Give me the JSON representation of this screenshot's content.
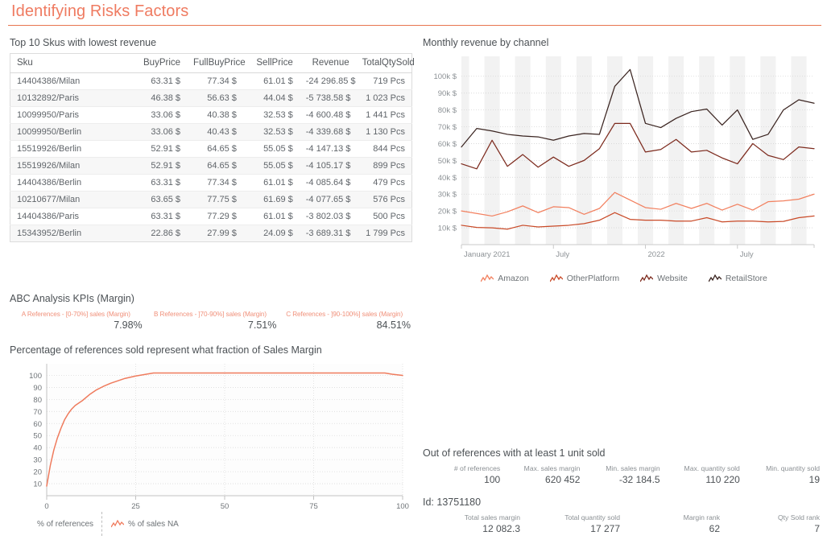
{
  "header": {
    "title": "Identifying Risks Factors",
    "accent": "#e8754f",
    "title_color": "#ef7b61"
  },
  "sku_table": {
    "title": "Top 10 Skus with lowest revenue",
    "columns": [
      "Sku",
      "BuyPrice",
      "FullBuyPrice",
      "SellPrice",
      "Revenue",
      "TotalQtySold"
    ],
    "rows": [
      [
        "14404386/Milan",
        "63.31 $",
        "77.34 $",
        "61.01 $",
        "-24 296.85 $",
        "719 Pcs"
      ],
      [
        "10132892/Paris",
        "46.38 $",
        "56.63 $",
        "44.04 $",
        "-5 738.58 $",
        "1 023 Pcs"
      ],
      [
        "10099950/Paris",
        "33.06 $",
        "40.38 $",
        "32.53 $",
        "-4 600.48 $",
        "1 441 Pcs"
      ],
      [
        "10099950/Berlin",
        "33.06 $",
        "40.43 $",
        "32.53 $",
        "-4 339.68 $",
        "1 130 Pcs"
      ],
      [
        "15519926/Berlin",
        "52.91 $",
        "64.65 $",
        "55.05 $",
        "-4 147.13 $",
        "844 Pcs"
      ],
      [
        "15519926/Milan",
        "52.91 $",
        "64.65 $",
        "55.05 $",
        "-4 105.17 $",
        "899 Pcs"
      ],
      [
        "14404386/Berlin",
        "63.31 $",
        "77.34 $",
        "61.01 $",
        "-4 085.64 $",
        "479 Pcs"
      ],
      [
        "10210677/Milan",
        "63.65 $",
        "77.75 $",
        "61.69 $",
        "-4 077.65 $",
        "576 Pcs"
      ],
      [
        "14404386/Paris",
        "63.31 $",
        "77.29 $",
        "61.01 $",
        "-3 802.03 $",
        "500 Pcs"
      ],
      [
        "15343952/Berlin",
        "22.86 $",
        "27.99 $",
        "24.09 $",
        "-3 689.31 $",
        "1 799 Pcs"
      ]
    ]
  },
  "revenue_chart": {
    "title": "Monthly revenue by channel"
  },
  "abc": {
    "title": "ABC Analysis KPIs (Margin)",
    "items": [
      {
        "label": "A References - [0-70%] sales (Margin)",
        "value": "7.98%"
      },
      {
        "label": "B References - ]70-90%] sales (Margin)",
        "value": "7.51%"
      },
      {
        "label": "C References - ]90-100%] sales (Margin)",
        "value": "84.51%"
      }
    ]
  },
  "pareto_chart": {
    "title": "Percentage of references sold represent what fraction of Sales Margin",
    "legend_axis_label": "% of references",
    "legend_series_label": "% of sales NA"
  },
  "references": {
    "title": "Out of references with at least 1 unit sold",
    "kpis": [
      {
        "label": "# of references",
        "value": "100"
      },
      {
        "label": "Max. sales margin",
        "value": "620 452"
      },
      {
        "label": "Min. sales margin",
        "value": "-32 184.5"
      },
      {
        "label": "Max. quantity sold",
        "value": "110 220"
      },
      {
        "label": "Min. quantity sold",
        "value": "19"
      }
    ],
    "id_line": "Id: 13751180",
    "detail_kpis": [
      {
        "label": "Total sales margin",
        "value": "12 082.3"
      },
      {
        "label": "Total quantity sold",
        "value": "17 277"
      },
      {
        "label": "Margin rank",
        "value": "62"
      },
      {
        "label": "Qty Sold rank",
        "value": "7"
      }
    ]
  },
  "chart_data": [
    {
      "type": "line",
      "title": "Monthly revenue by channel",
      "xlabel": "",
      "ylabel": "",
      "ylim": [
        0,
        105000
      ],
      "ytick_labels": [
        "10k $",
        "20k $",
        "30k $",
        "40k $",
        "50k $",
        "60k $",
        "70k $",
        "80k $",
        "90k $",
        "100k $"
      ],
      "yticks": [
        10000,
        20000,
        30000,
        40000,
        50000,
        60000,
        70000,
        80000,
        90000,
        100000
      ],
      "xtick_labels": [
        "January 2021",
        "July",
        "2022",
        "July"
      ],
      "xtick_indices": [
        0,
        6,
        12,
        18
      ],
      "grid": true,
      "legend_position": "bottom",
      "x": [
        "January 2021",
        "February 2021",
        "March 2021",
        "April 2021",
        "May 2021",
        "June 2021",
        "July 2021",
        "August 2021",
        "September 2021",
        "October 2021",
        "November 2021",
        "December 2021",
        "January 2022",
        "February 2022",
        "March 2022",
        "April 2022",
        "May 2022",
        "June 2022",
        "July 2022",
        "August 2022",
        "September 2022",
        "October 2022",
        "November 2022",
        "December 2022"
      ],
      "series": [
        {
          "name": "Amazon",
          "color": "#f2805f",
          "values": [
            20000,
            18500,
            17000,
            19500,
            23000,
            19000,
            22500,
            22000,
            18000,
            21500,
            31000,
            26500,
            22000,
            21000,
            24500,
            21500,
            24500,
            20500,
            24000,
            20500,
            25500,
            26000,
            27000,
            30000
          ]
        },
        {
          "name": "OtherPlatform",
          "color": "#c94a28",
          "values": [
            11500,
            10200,
            10000,
            9200,
            11500,
            10500,
            11000,
            11500,
            12500,
            14500,
            19000,
            15000,
            14500,
            14500,
            14000,
            14000,
            16000,
            13500,
            14000,
            14000,
            13500,
            13800,
            16000,
            17000
          ]
        },
        {
          "name": "Website",
          "color": "#7d2b1e",
          "values": [
            48000,
            45000,
            62000,
            46500,
            53500,
            46000,
            52000,
            46500,
            50000,
            57000,
            72000,
            72000,
            55000,
            56500,
            62500,
            55000,
            56000,
            51500,
            48000,
            60000,
            53000,
            50500,
            58000,
            57000
          ]
        },
        {
          "name": "RetailStore",
          "color": "#3a2420",
          "values": [
            58000,
            69000,
            67500,
            65500,
            64500,
            64000,
            62000,
            64500,
            66000,
            65500,
            94000,
            104000,
            72000,
            69500,
            75000,
            79000,
            80500,
            71000,
            80000,
            62500,
            65500,
            80000,
            86000,
            84000
          ]
        }
      ]
    },
    {
      "type": "line",
      "title": "Percentage of references sold represent what fraction of Sales Margin",
      "xlabel": "% of references",
      "ylabel": "",
      "xlim": [
        0,
        100
      ],
      "ylim": [
        0,
        105
      ],
      "xticks": [
        0,
        25,
        50,
        75,
        100
      ],
      "xtick_labels": [
        "0",
        "25",
        "50",
        "75",
        "100"
      ],
      "yticks": [
        10,
        20,
        30,
        40,
        50,
        60,
        70,
        80,
        90,
        100
      ],
      "ytick_labels": [
        "10",
        "20",
        "30",
        "40",
        "50",
        "60",
        "70",
        "80",
        "90",
        "100"
      ],
      "grid": true,
      "legend_position": "bottom",
      "series": [
        {
          "name": "% of sales NA",
          "color": "#ef7b5d",
          "x": [
            0,
            1,
            2,
            3,
            4,
            5,
            6,
            7,
            8,
            9,
            10,
            12,
            14,
            16,
            18,
            20,
            22,
            25,
            28,
            30,
            40,
            50,
            60,
            70,
            80,
            90,
            95,
            97,
            100
          ],
          "y": [
            8,
            25,
            38,
            48,
            56,
            63,
            68,
            72,
            75,
            77,
            79,
            84,
            88,
            91,
            93.5,
            95.5,
            97.5,
            99.5,
            101,
            102,
            102,
            102,
            102,
            102,
            102,
            102,
            102,
            101,
            100
          ]
        }
      ]
    }
  ]
}
